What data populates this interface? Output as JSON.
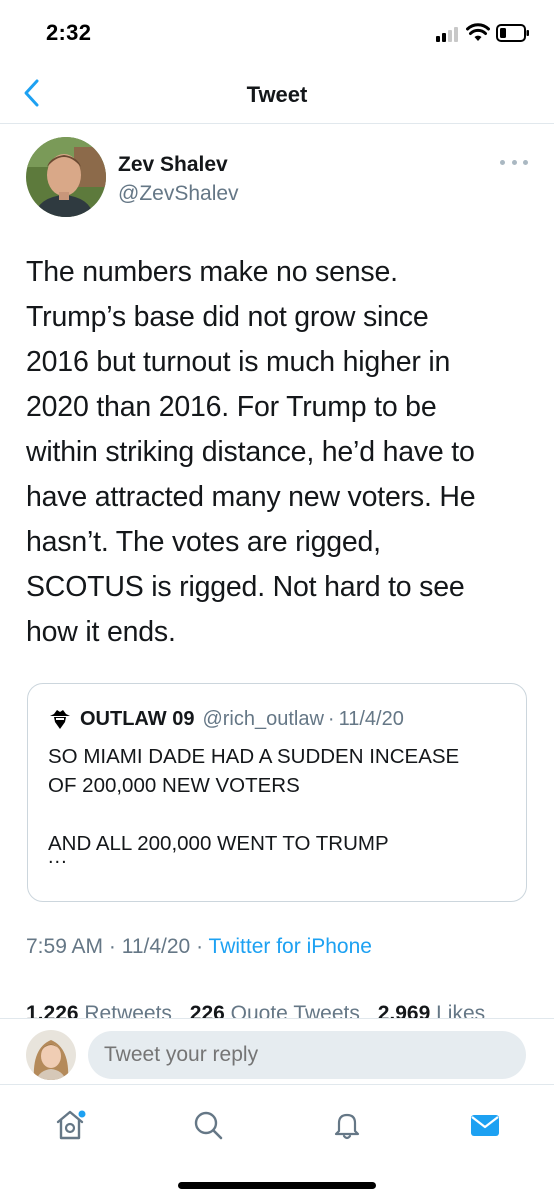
{
  "status_bar": {
    "time": "2:32"
  },
  "nav": {
    "title": "Tweet"
  },
  "tweet": {
    "author_name": "Zev Shalev",
    "author_handle": "@ZevShalev",
    "text": "The numbers make no sense.\nTrump’s base did not grow since\n2016 but turnout is much higher in\n2020 than 2016.  For Trump to be\nwithin striking distance, he’d have to\nhave attracted many new voters.  He\nhasn’t. The votes are rigged,\nSCOTUS is rigged. Not hard to see\nhow it ends.",
    "time": "7:59 AM",
    "date": "11/4/20",
    "source": "Twitter for iPhone",
    "separator": "·"
  },
  "quoted_tweet": {
    "name": "OUTLAW 09",
    "handle": "@rich_outlaw",
    "separator": "·",
    "date": "11/4/20",
    "text": "SO MIAMI DADE HAD A SUDDEN INCEASE\nOF 200,000 NEW VOTERS\n\nAND ALL 200,000 WENT TO TRUMP",
    "ellipsis": "..."
  },
  "stats": {
    "retweets_count": "1,226",
    "retweets_label": "Retweets",
    "quote_count": "226",
    "quote_label": "Quote Tweets",
    "likes_count": "2,969",
    "likes_label": "Likes"
  },
  "reply": {
    "placeholder": "Tweet your reply"
  },
  "tabs": [
    "home-icon",
    "search-icon",
    "notifications-icon",
    "messages-icon"
  ],
  "colors": {
    "accent": "#1da1f2",
    "secondary_text": "#657786",
    "primary_text": "#14171a"
  }
}
